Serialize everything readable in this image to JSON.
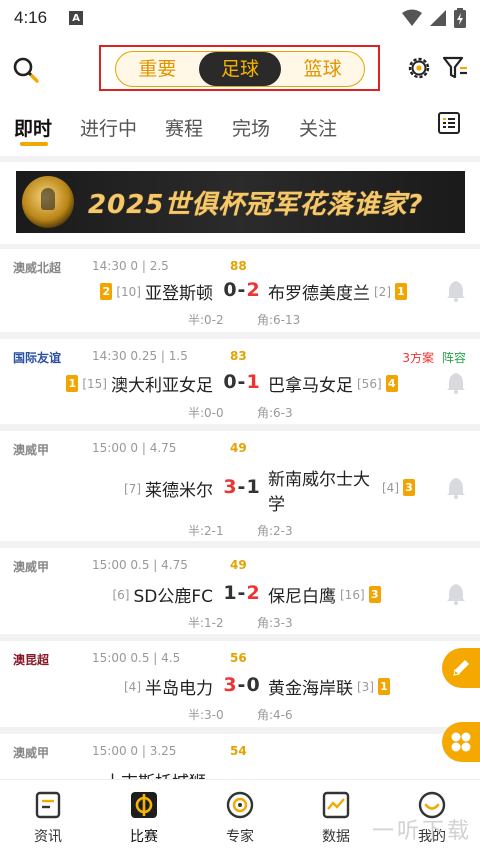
{
  "status": {
    "time": "4:16",
    "indicator": "A"
  },
  "header": {
    "segments": [
      {
        "label": "重要",
        "active": false
      },
      {
        "label": "足球",
        "active": true
      },
      {
        "label": "篮球",
        "active": false
      }
    ]
  },
  "tabs": [
    {
      "label": "即时",
      "active": true
    },
    {
      "label": "进行中",
      "active": false
    },
    {
      "label": "赛程",
      "active": false
    },
    {
      "label": "完场",
      "active": false
    },
    {
      "label": "关注",
      "active": false
    }
  ],
  "banner": {
    "text": "2025世俱杯冠军花落谁家?"
  },
  "matches": [
    {
      "league": "澳威北超",
      "info": "14:30  0 | 2.5",
      "minute": "88",
      "home_card": "2",
      "home_rank": "[10]",
      "home": "亚登斯顿",
      "score_home": "0",
      "score_sep": "-",
      "score_away": "2",
      "away": "布罗德美度兰",
      "away_rank": "[2]",
      "away_card": "1",
      "half": "半:0-2",
      "corner": "角:6-13"
    },
    {
      "league": "国际友谊",
      "info": "14:30  0.25 | 1.5",
      "minute": "83",
      "extra_red": "3方案",
      "extra_green": "阵容",
      "home_card": "1",
      "home_rank": "[15]",
      "home": "澳大利亚女足",
      "score_home": "0",
      "score_sep": "-",
      "score_away": "1",
      "away": "巴拿马女足",
      "away_rank": "[56]",
      "away_card": "4",
      "half": "半:0-0",
      "corner": "角:6-3"
    },
    {
      "league": "澳威甲",
      "info": "15:00  0 | 4.75",
      "minute": "49",
      "home_rank": "[7]",
      "home": "莱德米尔",
      "score_home": "3",
      "score_sep": "-",
      "score_away": "1",
      "away_line1": "新南威尔士大",
      "away_line2": "学",
      "away_rank": "[4]",
      "away_card": "3",
      "half": "半:2-1",
      "corner": "角:2-3"
    },
    {
      "league": "澳威甲",
      "info": "15:00  0.5 | 4.75",
      "minute": "49",
      "home_rank": "[6]",
      "home": "SD公鹿FC",
      "score_home": "1",
      "score_sep": "-",
      "score_away": "2",
      "away": "保尼白鹰",
      "away_rank": "[16]",
      "away_card": "3",
      "half": "半:1-2",
      "corner": "角:3-3"
    },
    {
      "league": "澳昆超",
      "info": "15:00  0.5 | 4.5",
      "minute": "56",
      "home_rank": "[4]",
      "home": "半岛电力",
      "score_home": "3",
      "score_sep": "-",
      "score_away": "0",
      "away": "黄金海岸联",
      "away_rank": "[3]",
      "away_card": "1",
      "half": "半:3-0",
      "corner": "角:4-6"
    },
    {
      "league": "澳威甲",
      "info": "15:00  0 | 3.25",
      "minute": "54",
      "home_partial": "十吉斯托城狮"
    }
  ],
  "bottom_nav": [
    {
      "label": "资讯",
      "icon": "news-icon",
      "active": false
    },
    {
      "label": "比赛",
      "icon": "match-icon",
      "active": true
    },
    {
      "label": "专家",
      "icon": "expert-icon",
      "active": false
    },
    {
      "label": "数据",
      "icon": "data-icon",
      "active": false
    },
    {
      "label": "我的",
      "icon": "profile-icon",
      "active": false
    }
  ],
  "watermark": "一听下载",
  "colors": {
    "accent": "#f5a800",
    "score_highlight": "#e33333",
    "selection_box": "#dd2222"
  }
}
